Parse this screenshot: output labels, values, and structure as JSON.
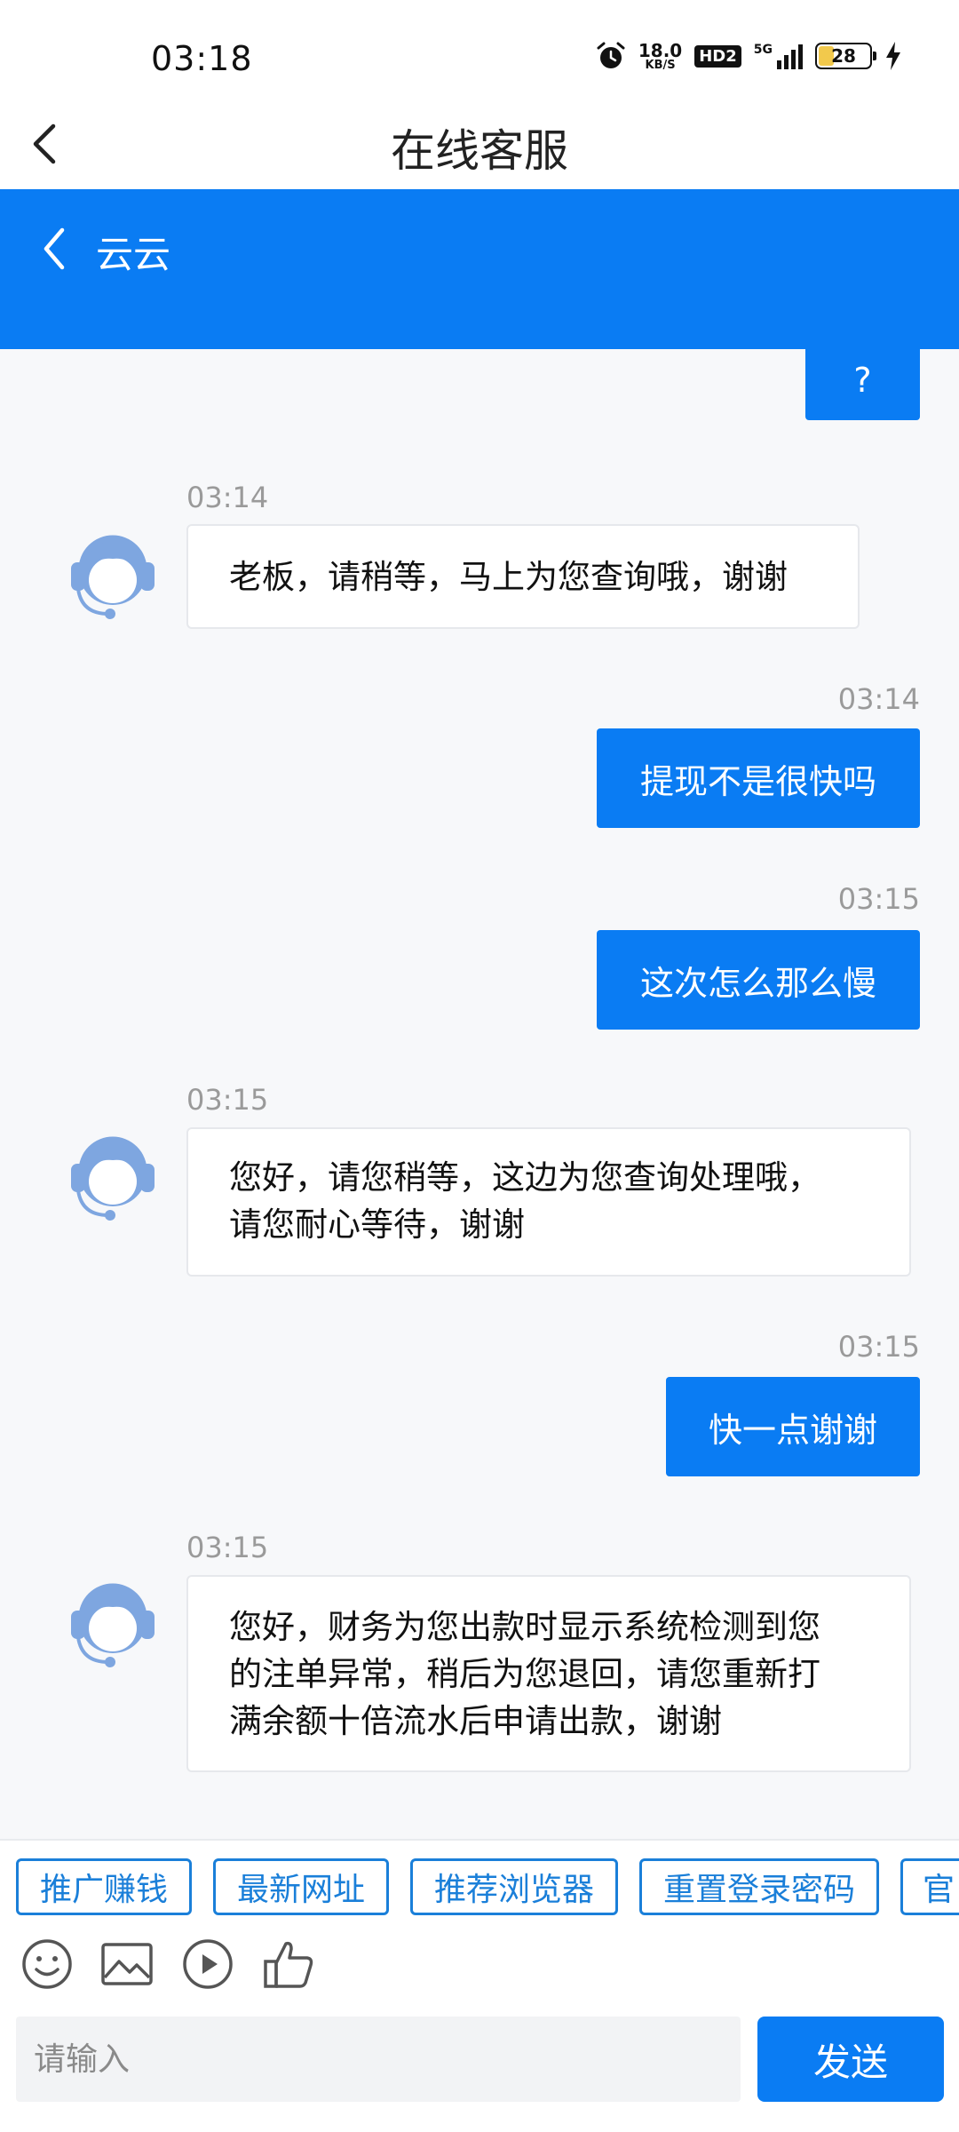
{
  "status_bar": {
    "time": "03:18",
    "net_speed_value": "18.0",
    "net_speed_unit": "KB/S",
    "hd_label": "HD2",
    "network_label": "5G",
    "battery_level": "28"
  },
  "title_bar": {
    "title": "在线客服"
  },
  "chat_header": {
    "agent_name": "云云"
  },
  "messages": [
    {
      "sender": "user",
      "text": "?"
    },
    {
      "sender": "agent",
      "time": "03:14",
      "text": "老板，请稍等，马上为您查询哦，谢谢"
    },
    {
      "sender": "user",
      "time": "03:14",
      "text": "提现不是很快吗"
    },
    {
      "sender": "user",
      "time": "03:15",
      "text": "这次怎么那么慢"
    },
    {
      "sender": "agent",
      "time": "03:15",
      "lines": [
        "您好，请您稍等，这边为您查询处理哦，",
        "请您耐心等待，谢谢"
      ]
    },
    {
      "sender": "user",
      "time": "03:15",
      "text": "快一点谢谢"
    },
    {
      "sender": "agent",
      "time": "03:15",
      "lines": [
        "您好，财务为您出款时显示系统检测到您",
        "的注单异常，稍后为您退回，请您重新打",
        "满余额十倍流水后申请出款，谢谢"
      ]
    }
  ],
  "quick_replies": [
    "推广赚钱",
    "最新网址",
    "推荐浏览器",
    "重置登录密码",
    "官"
  ],
  "tools": {
    "emoji": "emoji-icon",
    "image": "image-icon",
    "video": "play-icon",
    "rate": "thumbs-up-icon"
  },
  "input": {
    "placeholder": "请输入",
    "value": ""
  },
  "send_label": "发送",
  "colors": {
    "primary": "#0a7cf3",
    "quick_border": "#1a7fd9",
    "chat_bg": "#f7f8fa",
    "avatar": "#7ea6e0"
  }
}
